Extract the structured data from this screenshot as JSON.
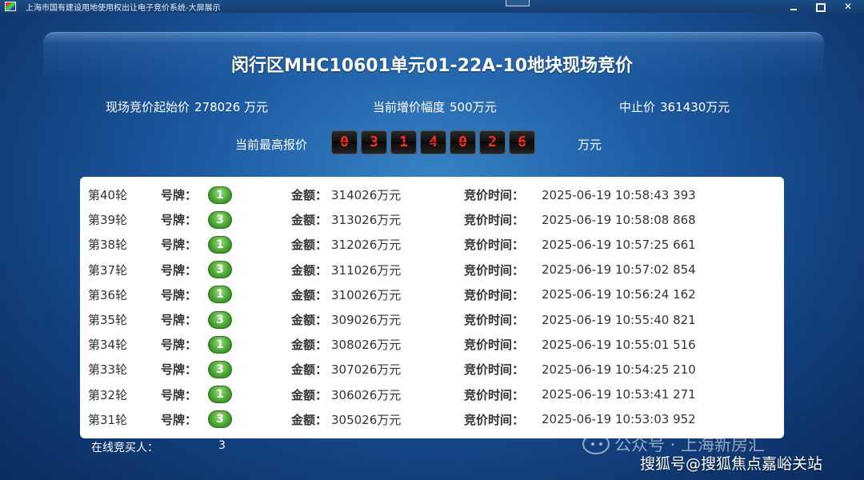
{
  "window": {
    "title": "上海市国有建设用地使用权出让电子竞价系统-大屏展示"
  },
  "auction": {
    "title": "闵行区MHC10601单元01-22A-10地块现场竞价",
    "start_price_label": "现场竞价起始价",
    "start_price_value": "278026 万元",
    "increment_label": "当前增价幅度",
    "increment_value": "500万元",
    "stop_price_label": "中止价",
    "stop_price_value": "361430万元",
    "highest_label": "当前最高报价",
    "highest_digits": [
      "0",
      "3",
      "1",
      "4",
      "0",
      "2",
      "6"
    ],
    "highest_unit": "万元"
  },
  "bid_labels": {
    "plate": "号牌：",
    "amount": "金额：",
    "time": "竞价时间："
  },
  "bids": [
    {
      "round": "第40轮",
      "plate": "1",
      "amount": "314026万元",
      "time": "2025-06-19 10:58:43 393"
    },
    {
      "round": "第39轮",
      "plate": "3",
      "amount": "313026万元",
      "time": "2025-06-19 10:58:08 868"
    },
    {
      "round": "第38轮",
      "plate": "1",
      "amount": "312026万元",
      "time": "2025-06-19 10:57:25 661"
    },
    {
      "round": "第37轮",
      "plate": "3",
      "amount": "311026万元",
      "time": "2025-06-19 10:57:02 854"
    },
    {
      "round": "第36轮",
      "plate": "1",
      "amount": "310026万元",
      "time": "2025-06-19 10:56:24 162"
    },
    {
      "round": "第35轮",
      "plate": "3",
      "amount": "309026万元",
      "time": "2025-06-19 10:55:40 821"
    },
    {
      "round": "第34轮",
      "plate": "1",
      "amount": "308026万元",
      "time": "2025-06-19 10:55:01 516"
    },
    {
      "round": "第33轮",
      "plate": "3",
      "amount": "307026万元",
      "time": "2025-06-19 10:54:25 210"
    },
    {
      "round": "第32轮",
      "plate": "1",
      "amount": "306026万元",
      "time": "2025-06-19 10:53:41 271"
    },
    {
      "round": "第31轮",
      "plate": "3",
      "amount": "305026万元",
      "time": "2025-06-19 10:53:03 952"
    }
  ],
  "online": {
    "label": "在线竞买人：",
    "count": "3"
  },
  "watermarks": {
    "wechat": "公众号 · 上海新房汇",
    "sohu": "搜狐号@搜狐焦点嘉峪关站"
  },
  "colors": {
    "digit_red": "#ff2a1e",
    "badge_green": "#3f9b2a",
    "background_blue": "#1f5fa6"
  }
}
